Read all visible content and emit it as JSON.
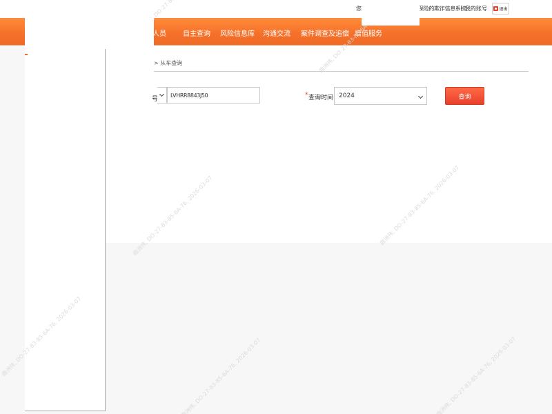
{
  "topbar": {
    "greeting": "您",
    "system_link": "保险的欺诈信息系统",
    "separator": "|",
    "my_account": "我的账号",
    "logout": "退出"
  },
  "nav": {
    "items": [
      "人员",
      "自主查询",
      "风险信息库",
      "沟通交流",
      "案件调查及追偿",
      "增值服务"
    ]
  },
  "breadcrumb": "> 从车查询",
  "form": {
    "left_label": "号",
    "vin_value": "LVHRR8843J50",
    "required_mark": "*",
    "time_label": "查询时间:",
    "time_value": "2024",
    "query_label": "查询"
  },
  "watermarks": [
    "曲洲伟, DO-27-83-85-6A-76, 2026-03-07",
    "曲洲伟, DO-27-83-85-6A-76, 2026-03-07",
    "曲洲伟, DO-27-83-85-6A-76, 2026-03-07",
    "曲洲伟, DO-27-83-85-6A-76, 2026-03-07",
    "曲洲伟, DO-27-83-85-6A-76, 2026-03-07",
    "曲洲伟, DO-27-83-85-6A-76, 2026-03-07",
    "曲洲伟, DO-27-83-85-6A-76, 2026-03-07"
  ],
  "colors": {
    "nav_orange": "#f5702a",
    "accent_red": "#e8402c"
  }
}
